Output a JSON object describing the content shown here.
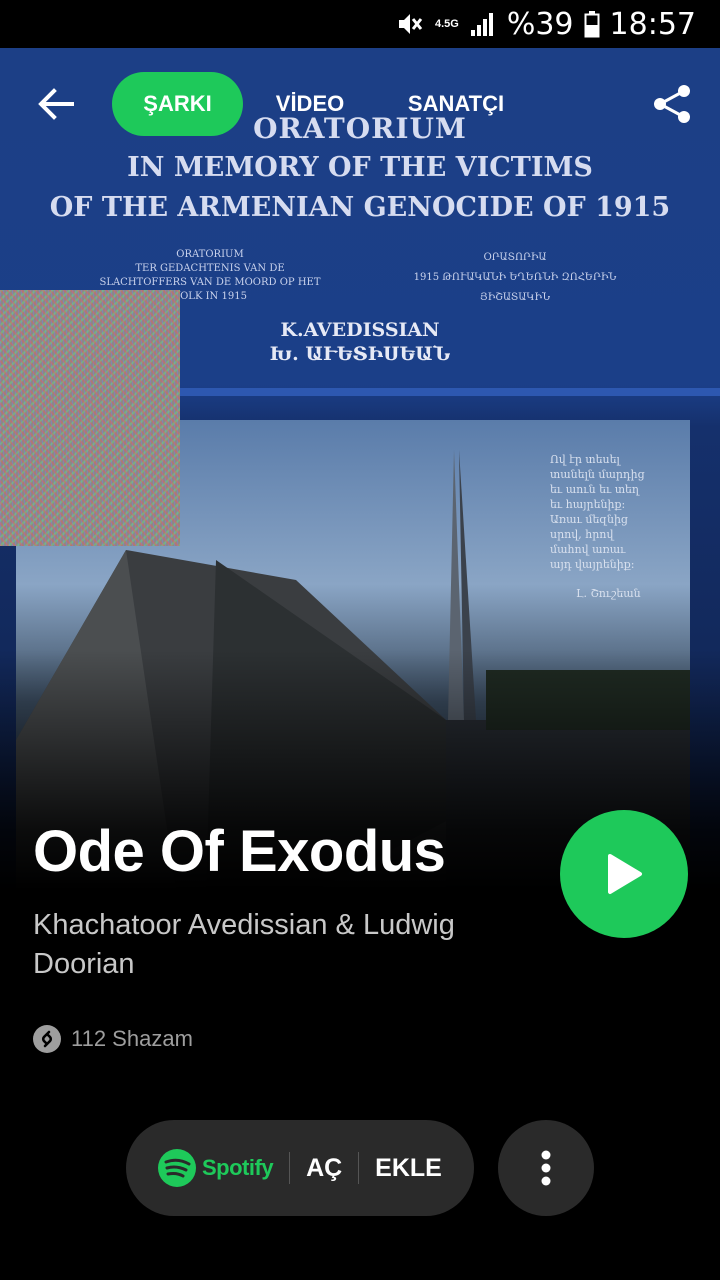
{
  "status_bar": {
    "network": "4.5G",
    "battery_percent": "%39",
    "time": "18:57"
  },
  "nav": {
    "tabs": [
      {
        "label": "ŞARKI",
        "active": true
      },
      {
        "label": "VİDEO",
        "active": false
      },
      {
        "label": "SANATÇI",
        "active": false
      }
    ]
  },
  "album_art": {
    "line1": "ORATORIUM",
    "line2": "IN MEMORY OF THE VICTIMS",
    "line3": "OF THE ARMENIAN GENOCIDE OF 1915",
    "left_small": "ORATORIUM\nTER GEDACHTENIS VAN DE\nSLACHTOFFERS VAN DE MOORD OP HET\nVOLK IN 1915",
    "right_small": "ՕՐԱՏՈՐԻԱ\n1915 ԹՈՒԱԿԱՆԻ ԵՂԵՌՆԻ ԶՈՀԵՐԻՆ\nՅԻՇԱՏԱԿԻՆ",
    "composer_latin": "K.AVEDISSIAN",
    "composer_armenian": "Խ. ԱՒԵՏԻՍԵԱՆ",
    "poem": "Ով էր տեսել\nտանելն մարդից\nեւ աուն եւ տեղ\nեւ հայրենիք:\nԱռաւ մեզնից\nսրով, հրով\nմահով առաւ\nայդ վայրենիք:",
    "poem_author": "Լ. Շուշեան"
  },
  "song": {
    "title": "Ode Of Exodus",
    "artist": "Khachatoor Avedissian & Ludwig Doorian",
    "shazam_count": "112 Shazam"
  },
  "actions": {
    "provider": "Spotify",
    "open_label": "AÇ",
    "add_label": "EKLE"
  },
  "colors": {
    "accent": "#1ec95a",
    "pill_bg": "#2a2a2a"
  }
}
